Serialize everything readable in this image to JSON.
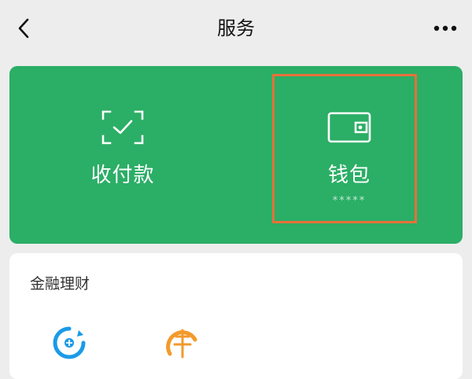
{
  "nav": {
    "title": "服务"
  },
  "card": {
    "pay_label": "收付款",
    "wallet_label": "钱包",
    "wallet_sub": "*****"
  },
  "finance": {
    "title": "金融理财"
  },
  "colors": {
    "green": "#2BAE66",
    "highlight": "#E8703A",
    "icon_blue": "#1A9BE8",
    "icon_orange": "#F39A2C"
  },
  "icons": {
    "back": "chevron-left-icon",
    "more": "more-dots-icon",
    "pay": "scan-check-icon",
    "wallet": "wallet-icon",
    "service1": "finance-blue-icon",
    "service2": "finance-orange-icon"
  }
}
